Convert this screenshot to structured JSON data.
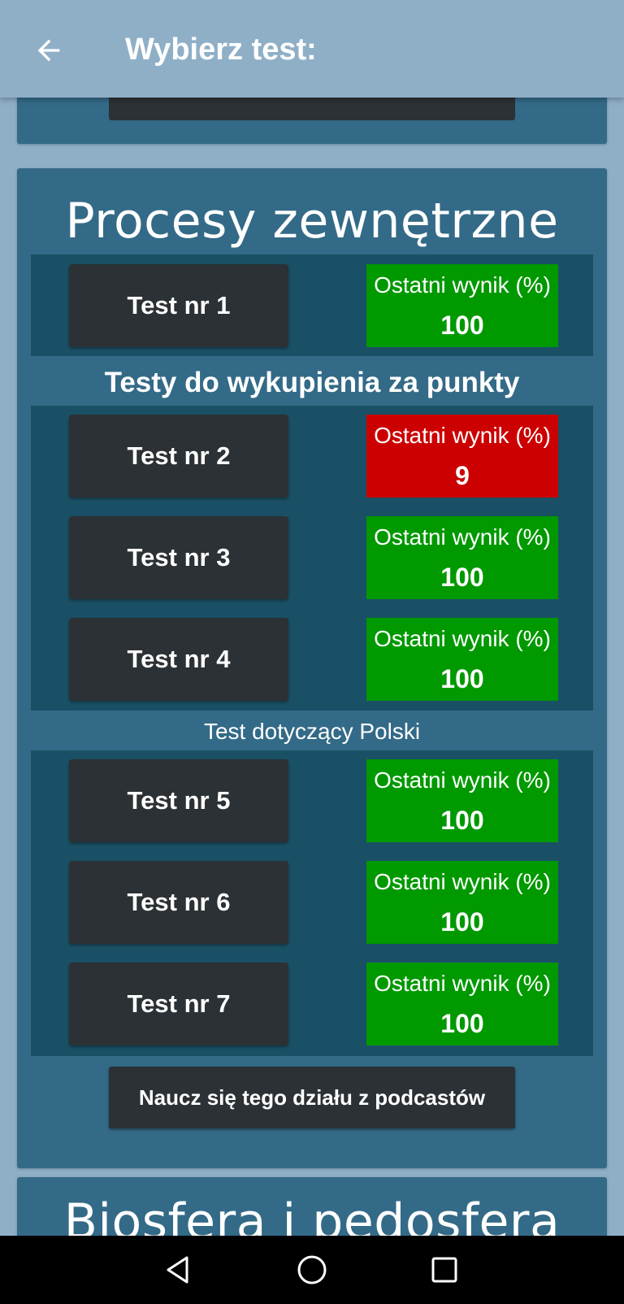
{
  "app_bar": {
    "title": "Wybierz test:",
    "back_icon": "arrow-back-icon"
  },
  "sections": [
    {
      "title": "Procesy zewnętrzne",
      "groups": [
        {
          "heading": "",
          "tests": [
            {
              "label": "Test nr 1",
              "score_label": "Ostatni wynik (%)",
              "score": "100",
              "status": "pass"
            }
          ]
        },
        {
          "heading": "Testy do wykupienia za punkty",
          "tests": [
            {
              "label": "Test nr 2",
              "score_label": "Ostatni wynik (%)",
              "score": "9",
              "status": "fail"
            },
            {
              "label": "Test nr 3",
              "score_label": "Ostatni wynik (%)",
              "score": "100",
              "status": "pass"
            },
            {
              "label": "Test nr 4",
              "score_label": "Ostatni wynik (%)",
              "score": "100",
              "status": "pass"
            }
          ]
        },
        {
          "heading": "Test dotyczący Polski",
          "tests": [
            {
              "label": "Test nr 5",
              "score_label": "Ostatni wynik (%)",
              "score": "100",
              "status": "pass"
            },
            {
              "label": "Test nr 6",
              "score_label": "Ostatni wynik (%)",
              "score": "100",
              "status": "pass"
            },
            {
              "label": "Test nr 7",
              "score_label": "Ostatni wynik (%)",
              "score": "100",
              "status": "pass"
            }
          ]
        }
      ],
      "podcast_button": "Naucz się tego działu z podcastów"
    },
    {
      "title": "Biosfera i pedosfera"
    }
  ],
  "colors": {
    "background": "#8fafc7",
    "card": "#336a87",
    "section": "#1a5065",
    "button": "#2b3135",
    "pass": "#009900",
    "fail": "#cc0000"
  },
  "nav_bar": {
    "icons": [
      "back-triangle-icon",
      "home-circle-icon",
      "recents-square-icon"
    ]
  }
}
